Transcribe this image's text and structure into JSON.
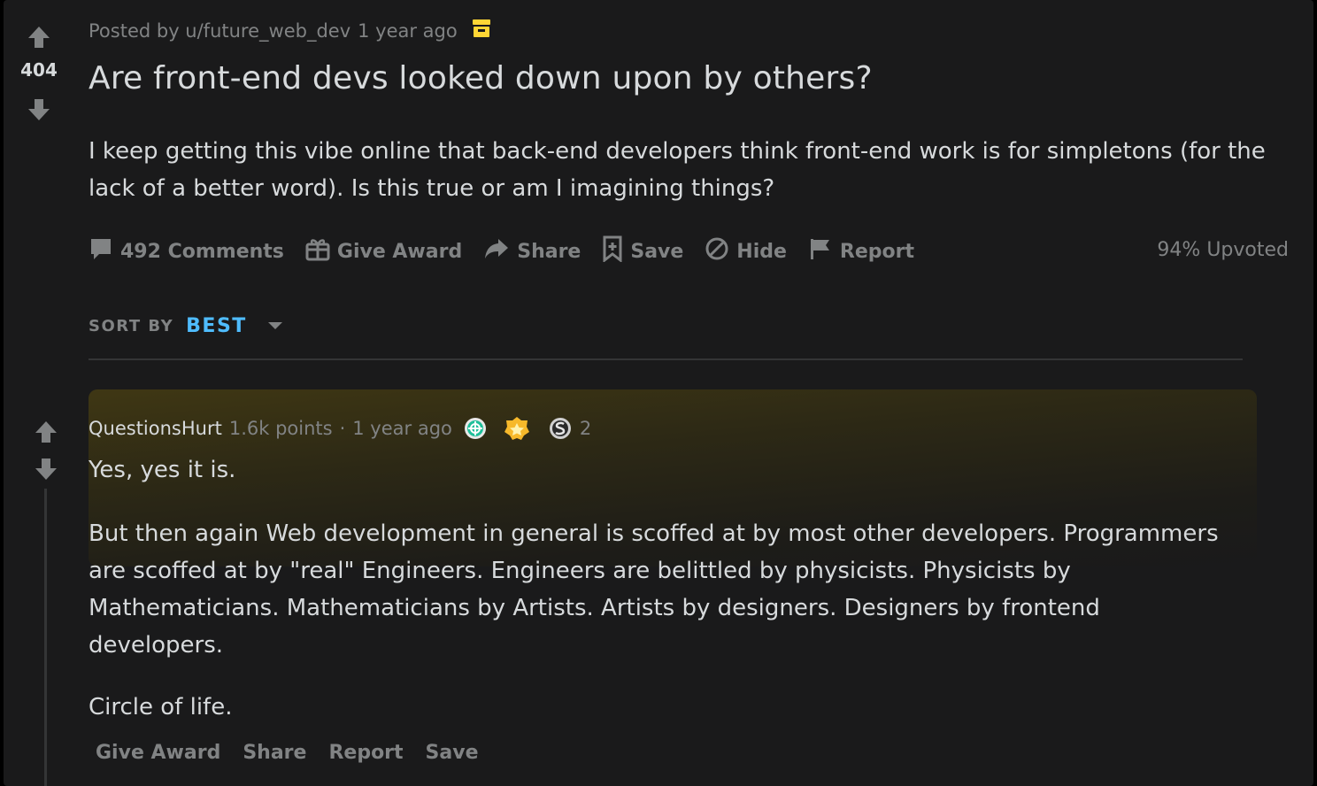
{
  "post": {
    "score": "404",
    "posted_by": "Posted by u/future_web_dev",
    "time": "1 year ago",
    "title": "Are front-end devs looked down upon by others?",
    "body": "I keep getting this vibe online that back-end developers think front-end work is for simpletons (for the lack of a better word). Is this true or am I imagining things?",
    "actions": {
      "comments": "492 Comments",
      "give_award": "Give Award",
      "share": "Share",
      "save": "Save",
      "hide": "Hide",
      "report": "Report"
    },
    "upvoted": "94% Upvoted"
  },
  "sort": {
    "label": "SORT BY",
    "value": "BEST"
  },
  "comment": {
    "author": "QuestionsHurt",
    "points": "1.6k points",
    "separator": "·",
    "time": "1 year ago",
    "award_count": "2",
    "paragraphs": [
      "Yes, yes it is.",
      "But then again Web development in general is scoffed at by most other developers. Programmers are scoffed at by \"real\" Engineers. Engineers are belittled by physicists. Physicists by Mathematicians. Mathematicians by Artists. Artists by designers. Designers by frontend developers.",
      "Circle of life."
    ],
    "actions": {
      "give_award": "Give Award",
      "share": "Share",
      "report": "Report",
      "save": "Save"
    }
  },
  "colors": {
    "background": "#1a1a1b",
    "text": "#d7dadc",
    "muted": "#818384",
    "accent": "#4fbcff",
    "archive": "#ffd635"
  }
}
